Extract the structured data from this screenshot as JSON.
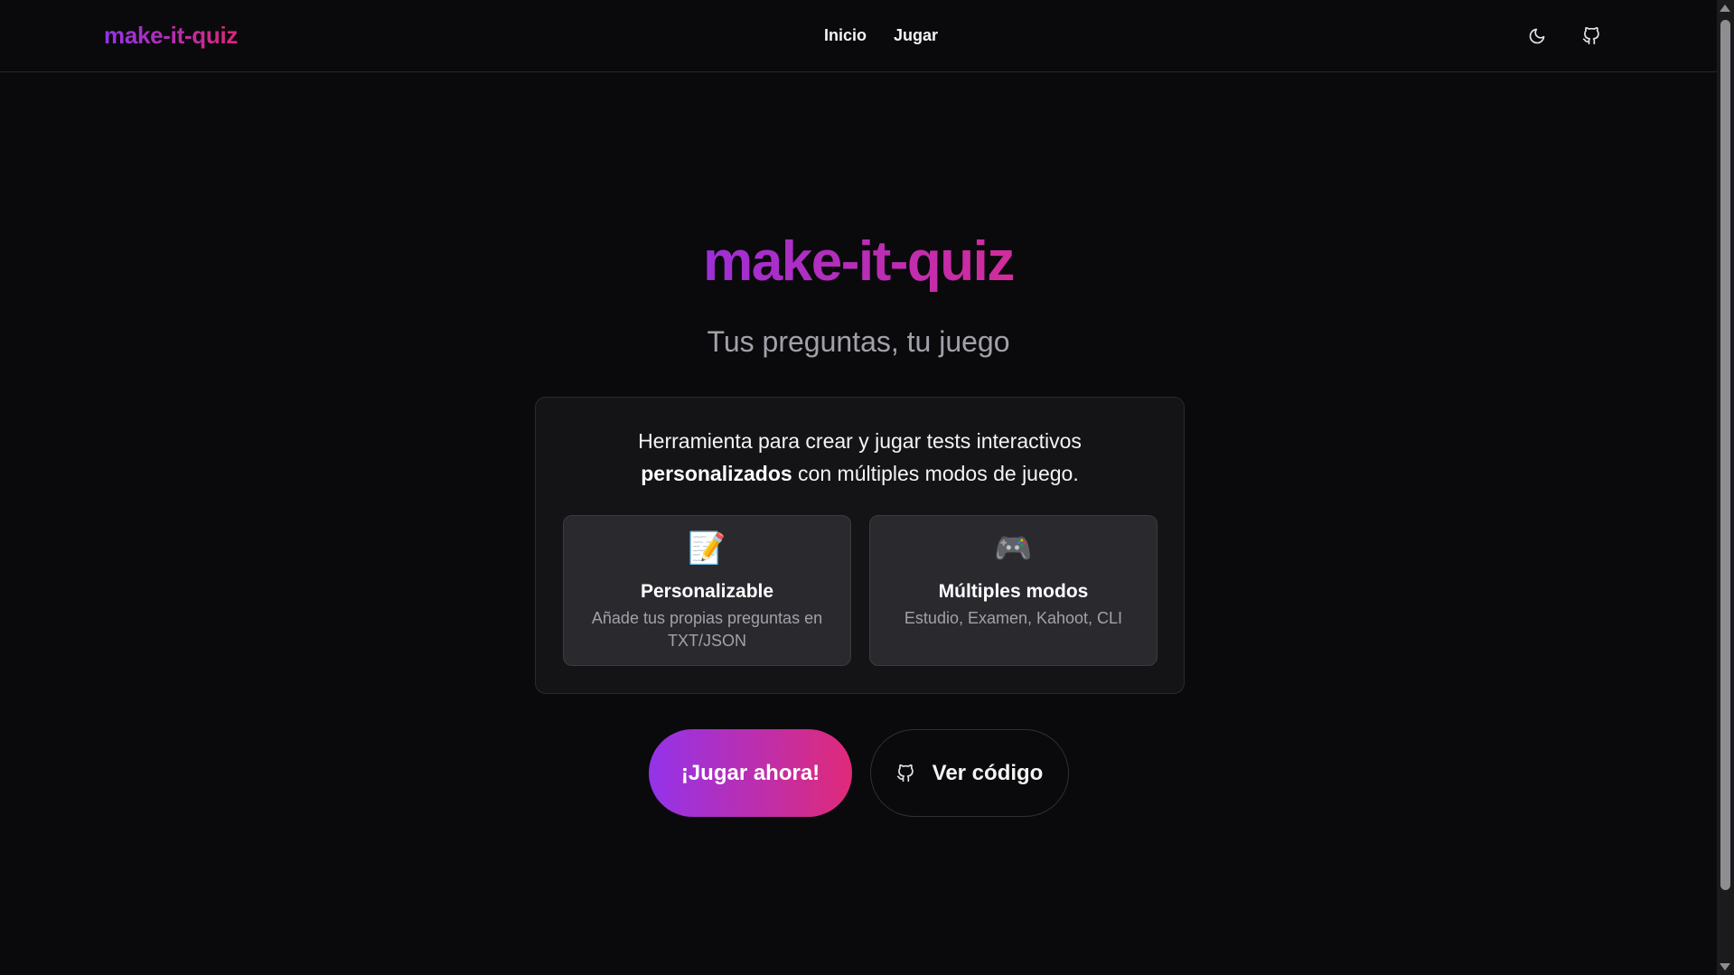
{
  "navbar": {
    "brand": "make-it-quiz",
    "links": [
      {
        "label": "Inicio"
      },
      {
        "label": "Jugar"
      }
    ],
    "theme_toggle_icon": "moon-icon",
    "github_icon": "github-icon"
  },
  "hero": {
    "title": "make-it-quiz",
    "subtitle": "Tus preguntas, tu juego"
  },
  "card": {
    "description_line1": "Herramienta para crear y jugar tests interactivos",
    "description_bold": "personalizados",
    "description_rest": " con múltiples modos de juego.",
    "features": [
      {
        "emoji": "📝",
        "title": "Personalizable",
        "text": "Añade tus propias preguntas en TXT/JSON"
      },
      {
        "emoji": "🎮",
        "title": "Múltiples modos",
        "text": "Estudio, Examen, Kahoot, CLI"
      }
    ]
  },
  "actions": {
    "play_label": "¡Jugar ahora!",
    "code_label": "Ver código"
  },
  "colors": {
    "background": "#0a0a0c",
    "gradient_start": "#9333ea",
    "gradient_end": "#db2777",
    "card_bg": "#141416",
    "feature_bg": "#2a2a2e"
  }
}
